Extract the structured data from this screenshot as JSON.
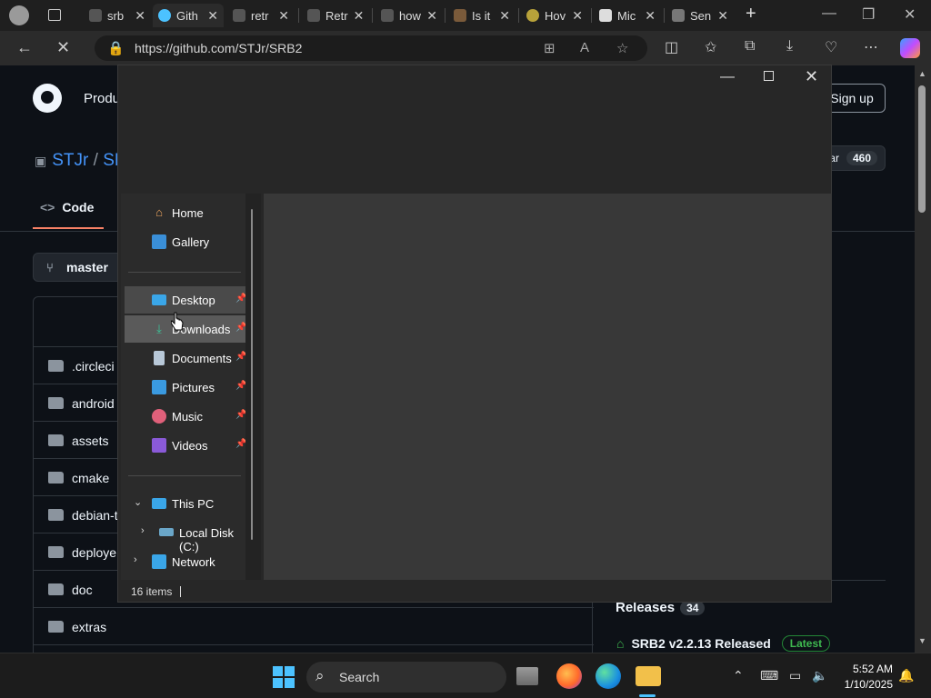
{
  "browser": {
    "tabs": [
      {
        "label": "srb",
        "active": false
      },
      {
        "label": "Gith",
        "active": true
      },
      {
        "label": "retr",
        "active": false
      },
      {
        "label": "Retr",
        "active": false
      },
      {
        "label": "how",
        "active": false
      },
      {
        "label": "Is it",
        "active": false
      },
      {
        "label": "Hov",
        "active": false
      },
      {
        "label": "Mic",
        "active": false
      },
      {
        "label": "Sen",
        "active": false
      }
    ],
    "url": "https://github.com/STJr/SRB2"
  },
  "github": {
    "product_label": "Produ",
    "signup_label": "Sign up",
    "repo_owner": "STJr",
    "repo_sep": "/",
    "repo_name_partial": "SR",
    "star_label": "ar",
    "star_count": "460",
    "code_tab": "Code",
    "branch": "master",
    "files": [
      ".circleci",
      "android",
      "assets",
      "cmake",
      "debian-t",
      "deploye",
      "doc",
      "extras"
    ],
    "releases_label": "Releases",
    "releases_count": "34",
    "latest_release": "SRB2 v2.2.13 Released",
    "latest_badge": "Latest"
  },
  "explorer": {
    "nav_quick": [
      {
        "label": "Home",
        "icon": "home-icon"
      },
      {
        "label": "Gallery",
        "icon": "gallery-icon"
      }
    ],
    "nav_pinned": [
      {
        "label": "Desktop",
        "icon": "desktop-icon"
      },
      {
        "label": "Downloads",
        "icon": "downloads-icon"
      },
      {
        "label": "Documents",
        "icon": "documents-icon"
      },
      {
        "label": "Pictures",
        "icon": "pictures-icon"
      },
      {
        "label": "Music",
        "icon": "music-icon"
      },
      {
        "label": "Videos",
        "icon": "videos-icon"
      }
    ],
    "nav_tree": [
      {
        "label": "This PC",
        "icon": "this-pc-icon",
        "expanded": true
      },
      {
        "label": "Local Disk (C:)",
        "icon": "drive-icon",
        "expanded": false
      },
      {
        "label": "Network",
        "icon": "network-icon",
        "expanded": false
      }
    ],
    "status_items": "16 items"
  },
  "taskbar": {
    "search_label": "Search",
    "time": "5:52 AM",
    "date": "1/10/2025"
  },
  "colors": {
    "accent": "#4cc2ff",
    "github_link": "#4493f8",
    "latest_green": "#3fb950"
  }
}
